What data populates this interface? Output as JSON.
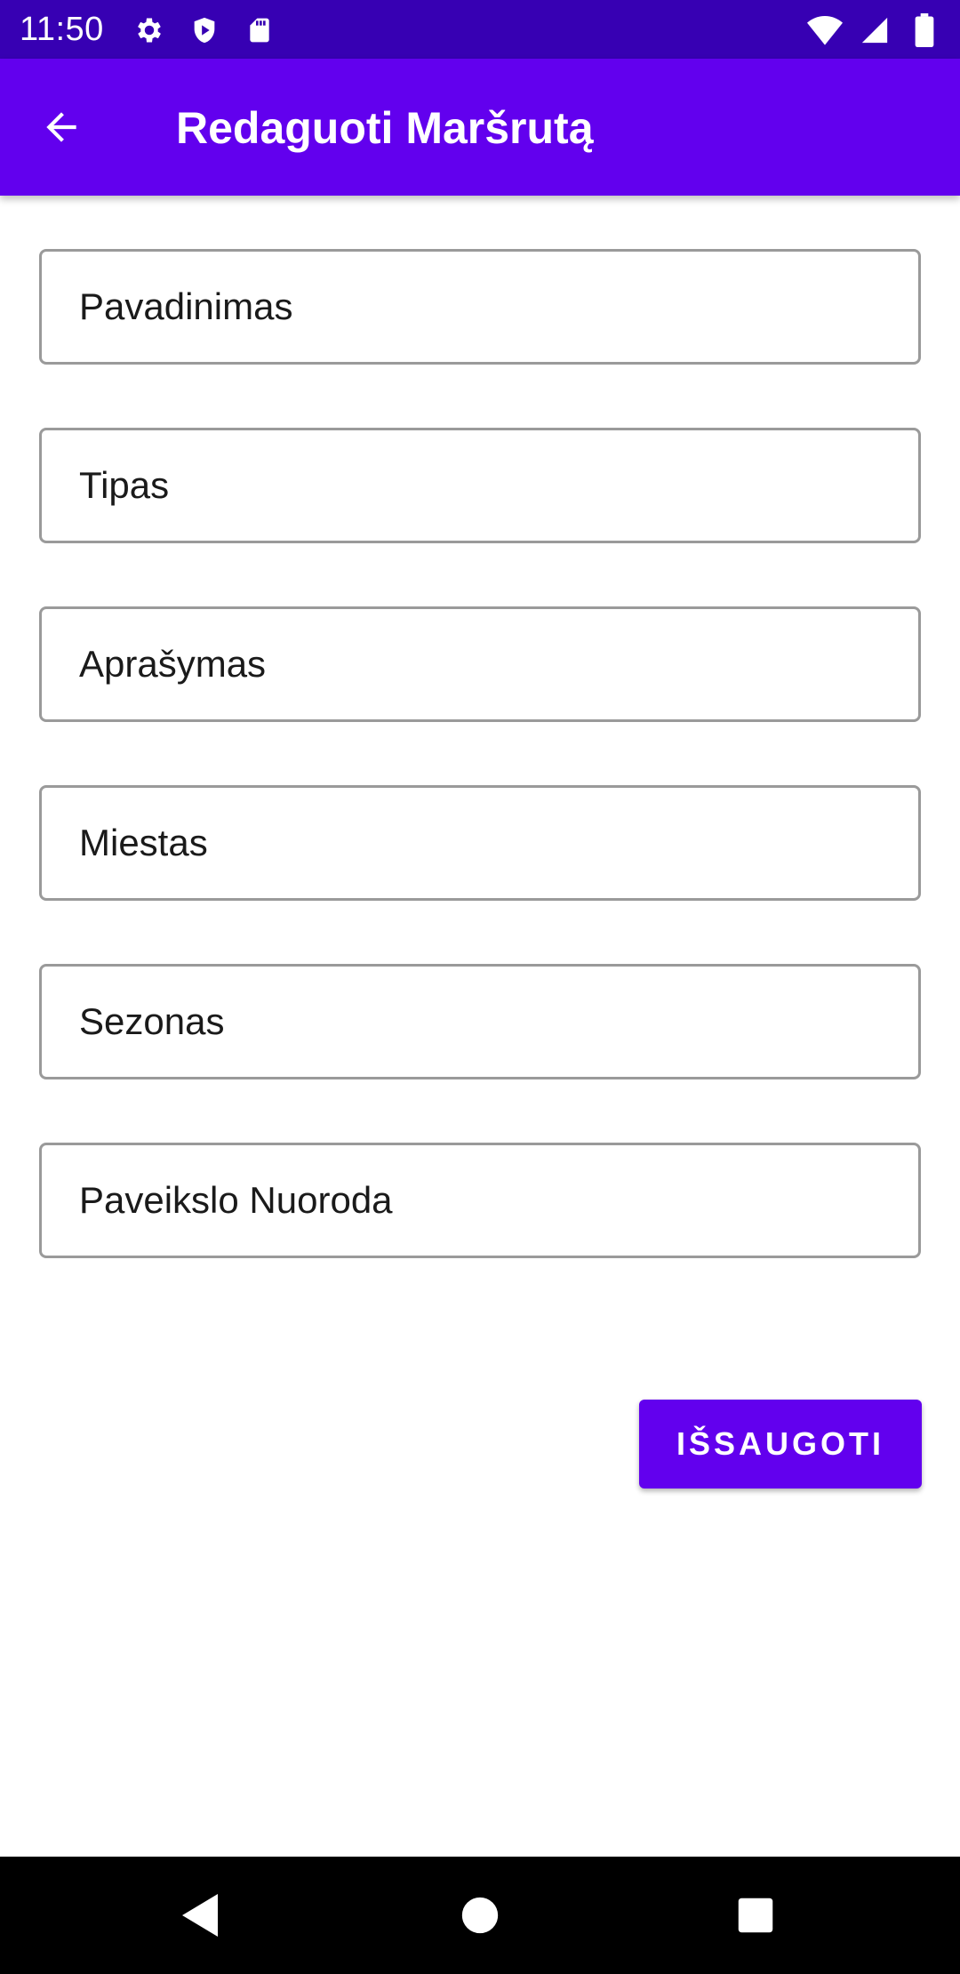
{
  "status_bar": {
    "time": "11:50",
    "left_icons": [
      "settings-icon",
      "shield-icon",
      "sd-card-icon"
    ],
    "right_icons": [
      "wifi-icon",
      "signal-icon",
      "battery-icon"
    ],
    "background": "#3700B3"
  },
  "app_bar": {
    "title": "Redaguoti Maršrutą",
    "back_icon": "arrow-back-icon",
    "background": "#6200EE"
  },
  "form": {
    "fields": [
      {
        "placeholder": "Pavadinimas",
        "value": ""
      },
      {
        "placeholder": "Tipas",
        "value": ""
      },
      {
        "placeholder": "Aprašymas",
        "value": ""
      },
      {
        "placeholder": "Miestas",
        "value": ""
      },
      {
        "placeholder": "Sezonas",
        "value": ""
      },
      {
        "placeholder": "Paveikslo Nuoroda",
        "value": ""
      }
    ]
  },
  "save_button": {
    "label": "IŠSAUGOTI",
    "background": "#6200EE"
  },
  "nav_bar": {
    "icons": [
      "back-triangle-icon",
      "home-circle-icon",
      "recents-square-icon"
    ]
  }
}
